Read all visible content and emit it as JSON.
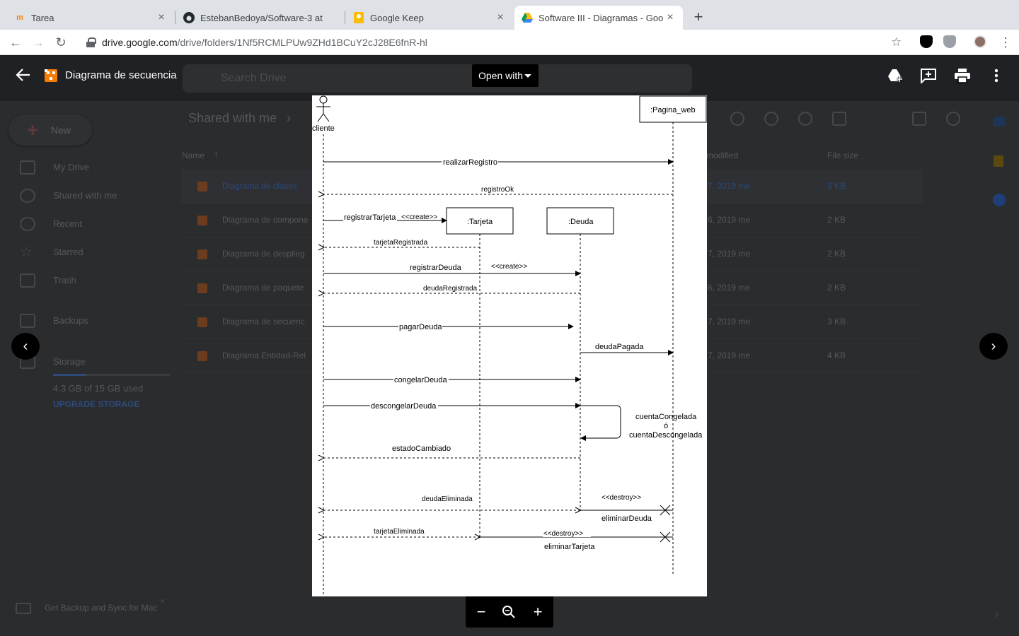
{
  "browser": {
    "tabs": [
      {
        "title": "Tarea",
        "active": false
      },
      {
        "title": "EstebanBedoya/Software-3 at",
        "active": false
      },
      {
        "title": "Google Keep",
        "active": false
      },
      {
        "title": "Software III - Diagramas - Goo",
        "active": true
      }
    ],
    "url_host": "drive.google.com",
    "url_path": "/drive/folders/1Nf5RCMLPUw9ZHd1BCuY2cJ28E6fnR-hl"
  },
  "drive": {
    "search_placeholder": "Search Drive",
    "new_label": "New",
    "sidebar": [
      {
        "label": "My Drive"
      },
      {
        "label": "Shared with me"
      },
      {
        "label": "Recent"
      },
      {
        "label": "Starred"
      },
      {
        "label": "Trash"
      },
      {
        "label": "Backups"
      },
      {
        "label": "Storage"
      }
    ],
    "storage_used": "4.3 GB of 15 GB used",
    "upgrade_label": "UPGRADE STORAGE",
    "breadcrumb": "Shared with me",
    "columns": {
      "name": "Name",
      "modified": "modified",
      "size": "File size"
    },
    "files": [
      {
        "name": "Diagrama de clases",
        "modified": "7, 2019  me",
        "size": "3 KB",
        "selected": true
      },
      {
        "name": "Diagrama de compone",
        "modified": "6, 2019  me",
        "size": "2 KB",
        "selected": false
      },
      {
        "name": "Diagrama de desplieg",
        "modified": "7, 2019  me",
        "size": "2 KB",
        "selected": false
      },
      {
        "name": "Diagrama de paquete",
        "modified": "6, 2019  me",
        "size": "2 KB",
        "selected": false
      },
      {
        "name": "Diagrama de secuenc",
        "modified": "7, 2019  me",
        "size": "3 KB",
        "selected": false
      },
      {
        "name": "Diagrama Entidad-Rel",
        "modified": "7, 2019  me",
        "size": "4 KB",
        "selected": false
      }
    ],
    "backup_promo": "Get Backup and Sync for Mac"
  },
  "viewer": {
    "title": "Diagrama de secuencia",
    "open_with_label": "Open with"
  },
  "diagram": {
    "lifelines": {
      "actor": "cliente",
      "tarjeta": ":Tarjeta",
      "deuda": ":Deuda",
      "pagina": ":Pagina_web"
    },
    "messages": {
      "realizarRegistro": "realizarRegistro",
      "registroOk": "registroOk",
      "registrarTarjeta": "registrarTarjeta",
      "create1": "<<create>>",
      "tarjetaRegistrada": "tarjetaRegistrada",
      "registrarDeuda": "registrarDeuda",
      "create2": "<<create>>",
      "deudaRegistrada": "deudaRegistrada",
      "pagarDeuda": "pagarDeuda",
      "deudaPagada": "deudaPagada",
      "congelarDeuda": "congelarDeuda",
      "descongelarDeuda": "descongelarDeuda",
      "cuenta1": "cuentaCongelada",
      "cuenta_o": "ó",
      "cuenta2": "cuentaDescongelada",
      "estadoCambiado": "estadoCambiado",
      "destroy1": "<<destroy>>",
      "deudaEliminada": "deudaEliminada",
      "eliminarDeuda": "eliminarDeuda",
      "tarjetaEliminada": "tarjetaEliminada",
      "destroy2": "<<destroy>>",
      "eliminarTarjeta": "eliminarTarjeta"
    }
  }
}
